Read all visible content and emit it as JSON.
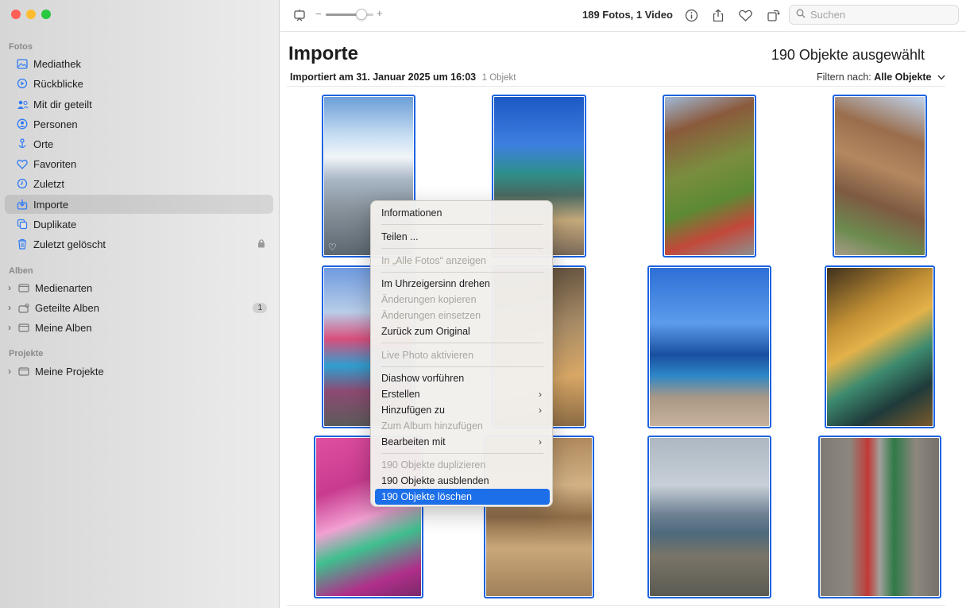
{
  "sidebar": {
    "sections": {
      "fotos": "Fotos",
      "alben": "Alben",
      "projekte": "Projekte"
    },
    "items": [
      {
        "label": "Mediathek",
        "icon": "photo-library-icon"
      },
      {
        "label": "Rückblicke",
        "icon": "memories-icon"
      },
      {
        "label": "Mit dir geteilt",
        "icon": "shared-with-you-icon"
      },
      {
        "label": "Personen",
        "icon": "people-icon"
      },
      {
        "label": "Orte",
        "icon": "places-icon"
      },
      {
        "label": "Favoriten",
        "icon": "heart-icon"
      },
      {
        "label": "Zuletzt",
        "icon": "recent-clock-icon"
      },
      {
        "label": "Importe",
        "icon": "import-icon"
      },
      {
        "label": "Duplikate",
        "icon": "duplicates-icon"
      },
      {
        "label": "Zuletzt gelöscht",
        "icon": "trash-icon"
      }
    ],
    "albums": [
      {
        "label": "Medienarten",
        "badge": ""
      },
      {
        "label": "Geteilte Alben",
        "badge": "1"
      },
      {
        "label": "Meine Alben",
        "badge": ""
      }
    ],
    "projects": [
      {
        "label": "Meine Projekte"
      }
    ]
  },
  "toolbar": {
    "zoom_minus": "−",
    "zoom_plus": "+",
    "zoom_level": 0.75,
    "count": "189 Fotos, 1 Video",
    "search_placeholder": "Suchen"
  },
  "main": {
    "title": "Importe",
    "selected": "190 Objekte ausgewählt",
    "import_title": "Importiert am 31. Januar 2025 um 16:03",
    "import_count": "1 Objekt",
    "filter_label": "Filtern nach:",
    "filter_value": "Alle Objekte"
  },
  "context_menu": {
    "items": [
      {
        "label": "Informationen",
        "enabled": true
      },
      {
        "label": "Teilen ...",
        "enabled": true
      },
      {
        "label": "In „Alle Fotos“ anzeigen",
        "enabled": false
      },
      {
        "label": "Im Uhrzeigersinn drehen",
        "enabled": true
      },
      {
        "label": "Änderungen kopieren",
        "enabled": false
      },
      {
        "label": "Änderungen einsetzen",
        "enabled": false
      },
      {
        "label": "Zurück zum Original",
        "enabled": true
      },
      {
        "label": "Live Photo aktivieren",
        "enabled": false
      },
      {
        "label": "Diashow vorführen",
        "enabled": true
      },
      {
        "label": "Erstellen",
        "enabled": true,
        "submenu": true
      },
      {
        "label": "Hinzufügen zu",
        "enabled": true,
        "submenu": true
      },
      {
        "label": "Zum Album hinzufügen",
        "enabled": false
      },
      {
        "label": "Bearbeiten mit",
        "enabled": true,
        "submenu": true
      },
      {
        "label": "190 Objekte duplizieren",
        "enabled": false
      },
      {
        "label": "190 Objekte ausblenden",
        "enabled": true
      },
      {
        "label": "190 Objekte löschen",
        "enabled": true,
        "highlighted": true
      }
    ]
  },
  "colors": {
    "accent": "#1c6fe8",
    "selection_border": "#1b63e0",
    "sidebar_icon": "#2f7bf5"
  }
}
